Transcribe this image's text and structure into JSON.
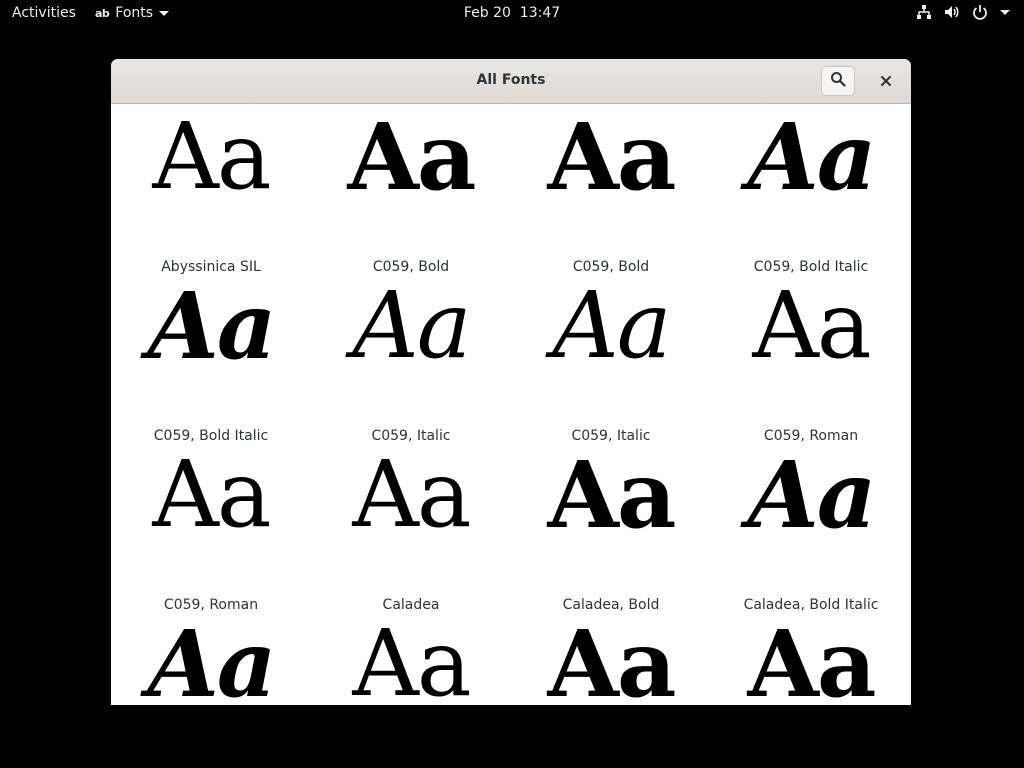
{
  "topbar": {
    "activities": "Activities",
    "app_name": "Fonts",
    "app_icon": "ab",
    "date": "Feb 20",
    "time": "13:47",
    "icons": [
      "network-icon",
      "volume-icon",
      "power-icon"
    ]
  },
  "window": {
    "title": "All Fonts",
    "search_icon": "search-icon",
    "close_icon": "close-icon"
  },
  "fonts": [
    {
      "sample": "Aa",
      "name": "Abyssinica SIL",
      "style": "regular"
    },
    {
      "sample": "Aa",
      "name": "C059, Bold",
      "style": "bold"
    },
    {
      "sample": "Aa",
      "name": "C059, Bold",
      "style": "bold"
    },
    {
      "sample": "Aa",
      "name": "C059, Bold Italic",
      "style": "bold-italic"
    },
    {
      "sample": "Aa",
      "name": "C059, Bold Italic",
      "style": "bold-italic"
    },
    {
      "sample": "Aa",
      "name": "C059, Italic",
      "style": "italic"
    },
    {
      "sample": "Aa",
      "name": "C059, Italic",
      "style": "italic"
    },
    {
      "sample": "Aa",
      "name": "C059, Roman",
      "style": "regular"
    },
    {
      "sample": "Aa",
      "name": "C059, Roman",
      "style": "regular"
    },
    {
      "sample": "Aa",
      "name": "Caladea",
      "style": "regular"
    },
    {
      "sample": "Aa",
      "name": "Caladea, Bold",
      "style": "bold"
    },
    {
      "sample": "Aa",
      "name": "Caladea, Bold Italic",
      "style": "bold-italic"
    },
    {
      "sample": "Aa",
      "name": "",
      "style": "bold-italic"
    },
    {
      "sample": "Aa",
      "name": "",
      "style": "regular"
    },
    {
      "sample": "Aa",
      "name": "",
      "style": "bold"
    },
    {
      "sample": "Aa",
      "name": "",
      "style": "bold"
    }
  ]
}
